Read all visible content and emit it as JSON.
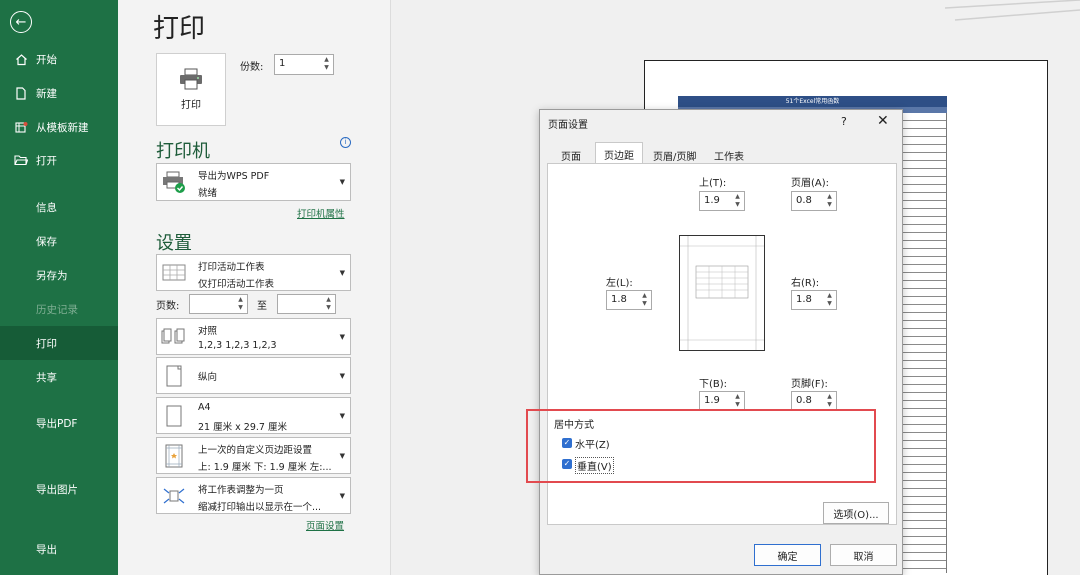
{
  "sidebar": {
    "items": [
      {
        "label": "开始",
        "icon": "home-icon"
      },
      {
        "label": "新建",
        "icon": "new-file-icon"
      },
      {
        "label": "从模板新建",
        "icon": "template-icon"
      },
      {
        "label": "打开",
        "icon": "folder-open-icon"
      },
      {
        "label": "信息"
      },
      {
        "label": "保存"
      },
      {
        "label": "另存为"
      },
      {
        "label": "历史记录"
      },
      {
        "label": "打印"
      },
      {
        "label": "共享"
      },
      {
        "label": "导出PDF"
      },
      {
        "label": "导出图片"
      },
      {
        "label": "导出"
      }
    ]
  },
  "main": {
    "title": "打印",
    "print_button": "打印",
    "copies_label": "份数:",
    "copies_value": "1",
    "printer_heading": "打印机",
    "printer_name": "导出为WPS PDF",
    "printer_status": "就绪",
    "printer_props_link": "打印机属性",
    "settings_heading": "设置",
    "scope_line1": "打印活动工作表",
    "scope_line2": "仅打印活动工作表",
    "pages_label": "页数:",
    "to_label": "至",
    "collate_line1": "对照",
    "collate_line2": "1,2,3    1,2,3    1,2,3",
    "orientation": "纵向",
    "paper_line1": "A4",
    "paper_line2": "21 厘米 x 29.7 厘米",
    "margins_line1": "上一次的自定义页边距设置",
    "margins_line2": "上: 1.9 厘米 下: 1.9 厘米 左:...",
    "scale_line1": "将工作表调整为一页",
    "scale_line2": "缩减打印输出以显示在一个...",
    "page_setup_link": "页面设置"
  },
  "preview": {
    "sheet_title": "51个Excel常用函数"
  },
  "dialog": {
    "title": "页面设置",
    "help": "?",
    "close": "✕",
    "tabs": [
      "页面",
      "页边距",
      "页眉/页脚",
      "工作表"
    ],
    "top_label": "上(T):",
    "top_value": "1.9",
    "header_label": "页眉(A):",
    "header_value": "0.8",
    "left_label": "左(L):",
    "left_value": "1.8",
    "right_label": "右(R):",
    "right_value": "1.8",
    "bottom_label": "下(B):",
    "bottom_value": "1.9",
    "footer_label": "页脚(F):",
    "footer_value": "0.8",
    "center_heading": "居中方式",
    "horizontal_label": "水平(Z)",
    "horizontal_checked": true,
    "vertical_label": "垂直(V)",
    "vertical_checked": true,
    "options_button": "选项(O)...",
    "ok_button": "确定",
    "cancel_button": "取消"
  },
  "colors": {
    "sidebar": "#1e7145",
    "sidebar_active": "#165c37",
    "highlight": "#e24a4f",
    "checkbox": "#2f6fcf"
  }
}
